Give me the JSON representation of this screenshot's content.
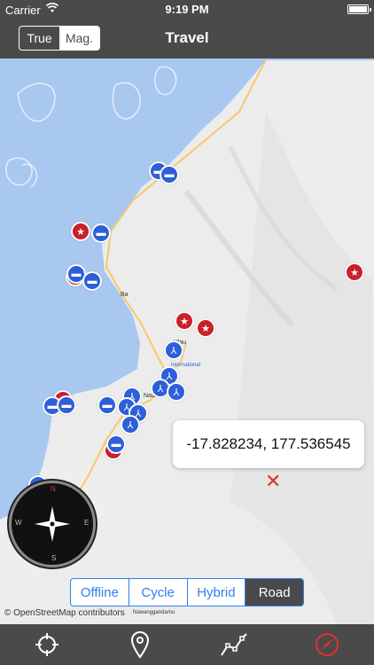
{
  "status": {
    "carrier": "Carrier",
    "time": "9:19 PM"
  },
  "nav": {
    "title": "Travel",
    "true_label": "True",
    "mag_label": "Mag."
  },
  "map": {
    "callout_text": "-17.828234, 177.536545",
    "attribution": "© OpenStreetMap contributors",
    "place_labels": {
      "ba": "Ba",
      "nadi": "Nadi",
      "vlau": "Vlau",
      "international": "International",
      "nawang": "Nawanggandamu"
    }
  },
  "compass": {
    "n": "N",
    "s": "S",
    "e": "E",
    "w": "W"
  },
  "map_types": {
    "offline": "Offline",
    "cycle": "Cycle",
    "hybrid": "Hybrid",
    "road": "Road",
    "selected": "Road"
  },
  "tabs": [
    "location-crosshair-icon",
    "pin-icon",
    "route-icon",
    "compass-icon"
  ],
  "colors": {
    "bar": "#4a4a4a",
    "accent": "#2f80ed",
    "red_marker": "#c9212a",
    "blue_marker": "#2d5fd8",
    "sea": "#a8c8f0"
  }
}
